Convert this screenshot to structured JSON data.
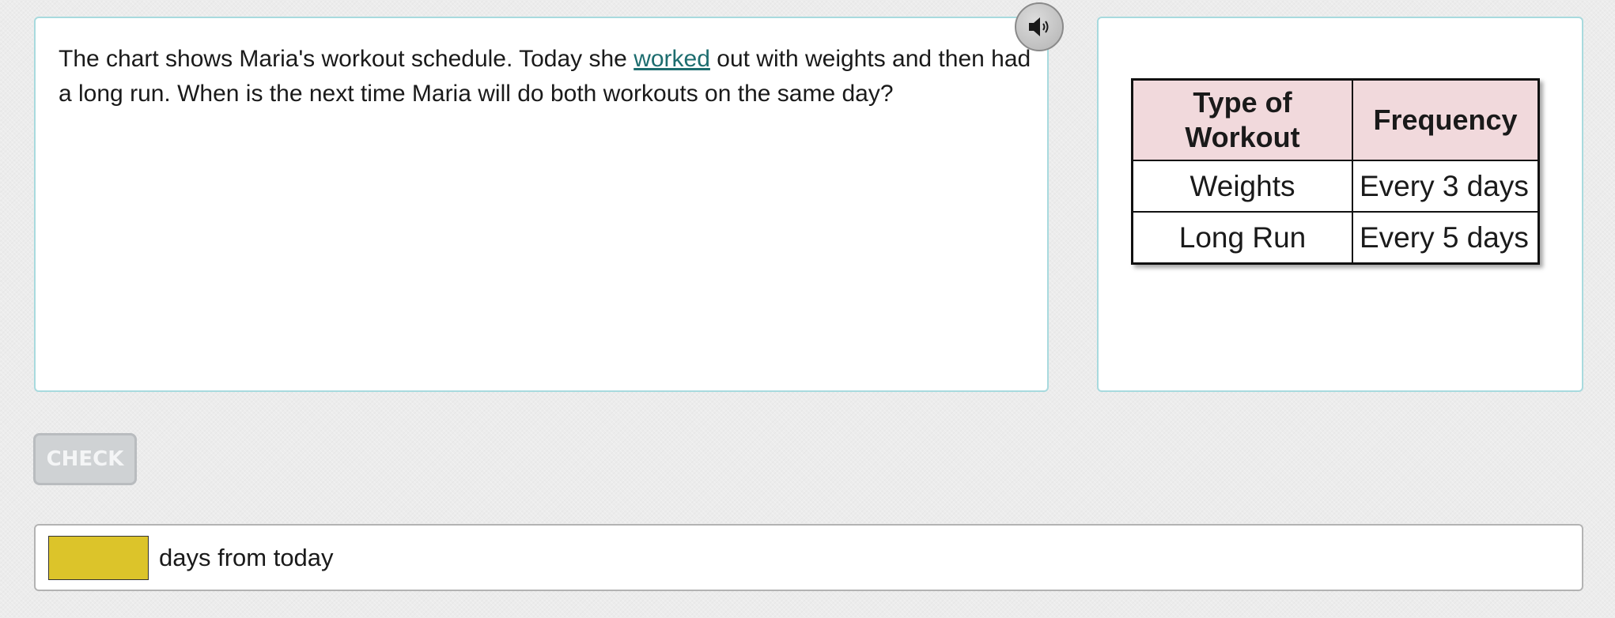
{
  "question": {
    "text_before": "The chart shows Maria's workout schedule. Today she ",
    "link_text": "worked",
    "text_after": " out with weights and then had a long run. When is the next time Maria will do both workouts on the same day?"
  },
  "audio": {
    "icon": "speaker-icon"
  },
  "table": {
    "headers": {
      "type": "Type of Workout",
      "frequency": "Frequency"
    },
    "rows": [
      {
        "type": "Weights",
        "frequency": "Every 3 days"
      },
      {
        "type": "Long Run",
        "frequency": "Every 5 days"
      }
    ],
    "header_color": "#f1d9dc"
  },
  "check_button": {
    "label": "CHECK"
  },
  "answer": {
    "value": "",
    "placeholder": "",
    "suffix": "days from today",
    "input_color": "#dcc42a"
  },
  "colors": {
    "panel_border": "#a8dade",
    "link": "#1d6d6f"
  }
}
